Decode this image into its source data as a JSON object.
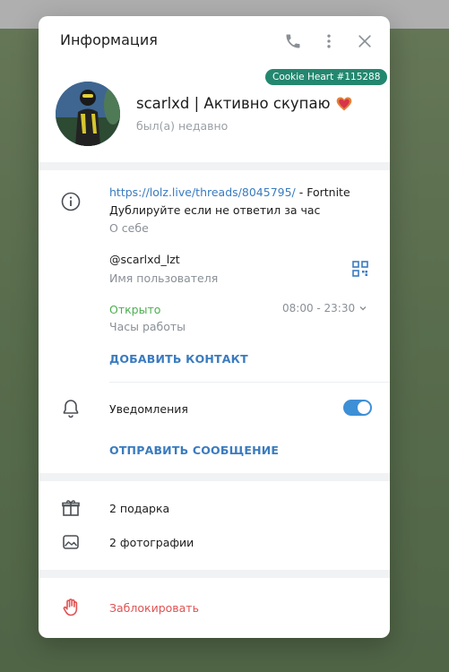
{
  "header": {
    "title": "Информация",
    "icons": [
      "phone-icon",
      "more-vertical-icon",
      "close-icon"
    ]
  },
  "profile": {
    "name": "scarlxd | Активно скупаю",
    "last_seen": "был(а) недавно",
    "badge": "Cookie Heart #115288",
    "emoji_icon": "cookie-heart-icon"
  },
  "info": {
    "bio_link": "https://lolz.live/threads/8045795/",
    "bio_rest": " - Fortnite",
    "bio_line2": "Дублируйте если не ответил за час",
    "bio_label": "О себе",
    "username": "@scarlxd_lzt",
    "username_label": "Имя пользователя",
    "open_status": "Открыто",
    "hours": "08:00 - 23:30",
    "hours_label": "Часы работы",
    "add_contact": "ДОБАВИТЬ КОНТАКТ"
  },
  "notifications": {
    "label": "Уведомления",
    "enabled": true,
    "send_message": "ОТПРАВИТЬ СООБЩЕНИЕ"
  },
  "media": {
    "gifts": "2 подарка",
    "photos": "2 фотографии"
  },
  "danger": {
    "block": "Заблокировать"
  },
  "colors": {
    "accent": "#3a7bbf",
    "open": "#4caf50",
    "danger": "#e05252",
    "badge": "#23876f",
    "toggle": "#3d8fd6"
  }
}
